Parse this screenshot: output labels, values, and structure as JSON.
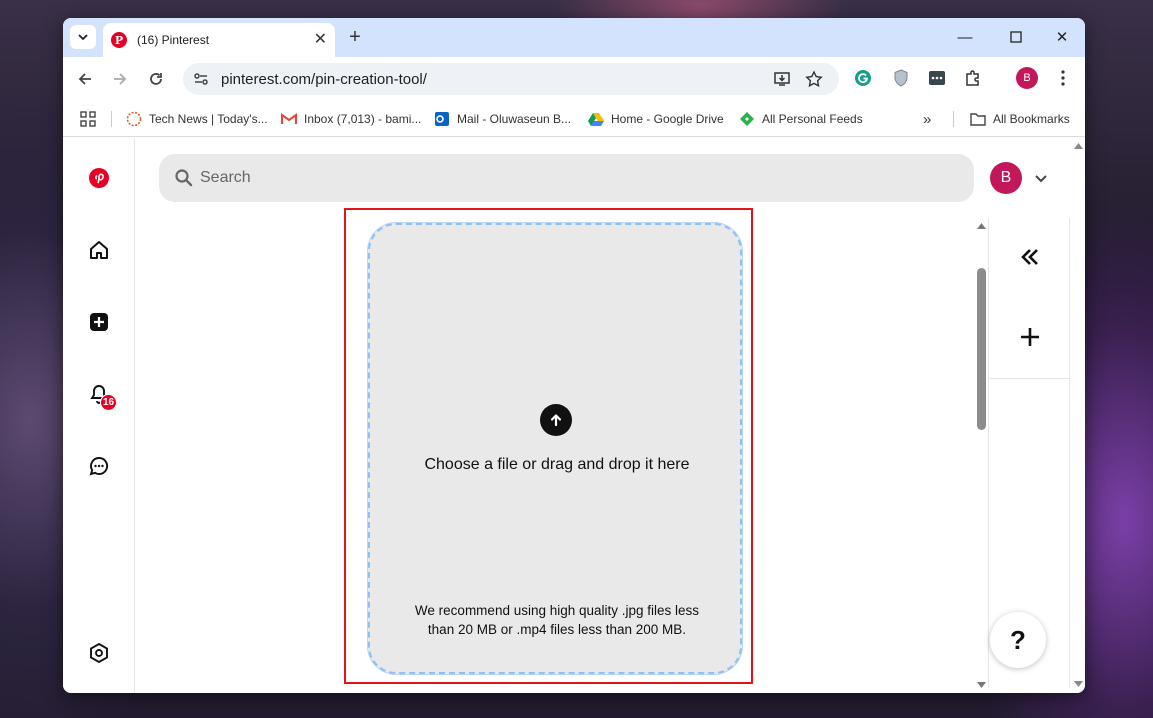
{
  "browser": {
    "tab_title": "(16) Pinterest",
    "url": "pinterest.com/pin-creation-tool/"
  },
  "bookmarks": {
    "items": [
      {
        "label": "Tech News | Today's...",
        "icon": "tech-news-icon"
      },
      {
        "label": "Inbox (7,013) - bami...",
        "icon": "gmail-icon"
      },
      {
        "label": "Mail - Oluwaseun B...",
        "icon": "outlook-icon"
      },
      {
        "label": "Home - Google Drive",
        "icon": "google-drive-icon"
      },
      {
        "label": "All Personal Feeds",
        "icon": "feedly-icon"
      }
    ],
    "all_bookmarks_label": "All Bookmarks"
  },
  "sidebar": {
    "notification_count": "16"
  },
  "header": {
    "search_placeholder": "Search",
    "avatar_initial": "B",
    "profile_initial": "B"
  },
  "upload": {
    "prompt": "Choose a file or drag and drop it here",
    "recommendation": "We recommend using high quality .jpg files less than 20 MB or .mp4 files less than 200 MB."
  },
  "right_panel": {
    "collapse_symbol": "«",
    "add_symbol": "+"
  },
  "help": {
    "label": "?"
  },
  "colors": {
    "brand": "#e60023",
    "highlight": "#e0141a",
    "avatar": "#c2185b",
    "tabbar": "#d3e3fd"
  }
}
